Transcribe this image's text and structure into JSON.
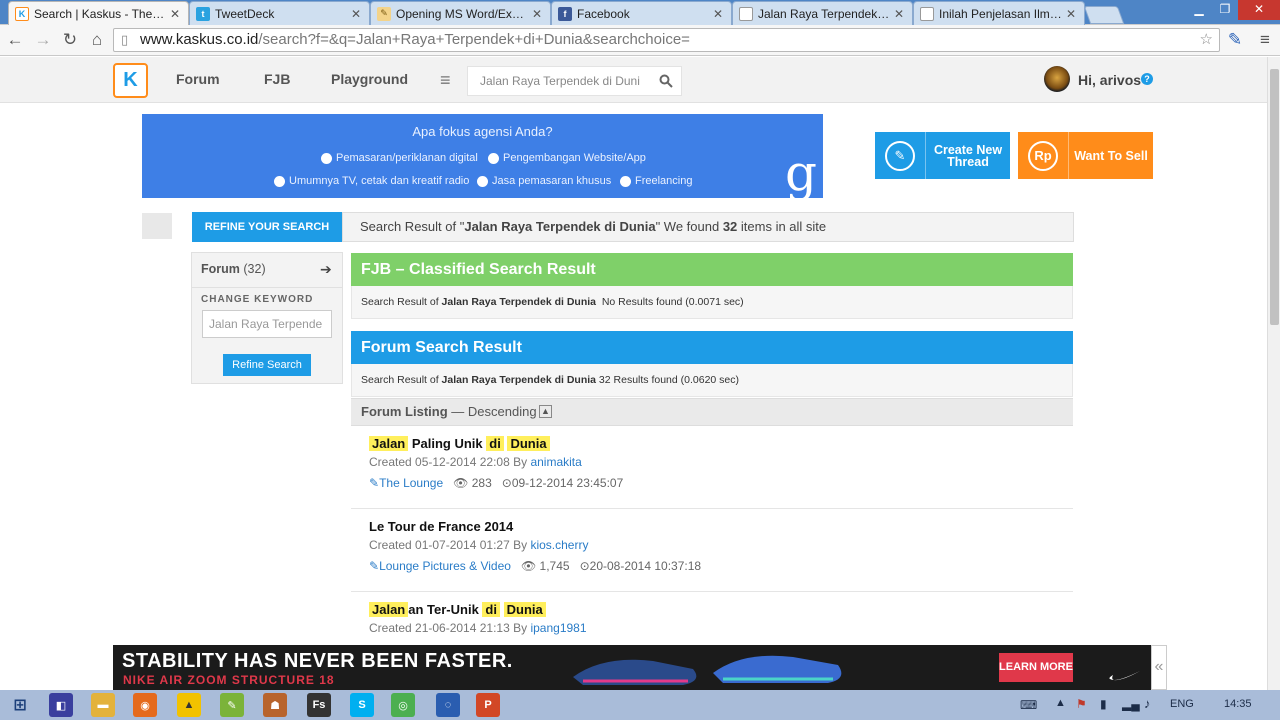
{
  "browser": {
    "tabs": [
      {
        "title": "Search | Kaskus - The Larg",
        "icon": "kaskus-icon",
        "active": true
      },
      {
        "title": "TweetDeck",
        "icon": "tweetdeck-icon",
        "active": false
      },
      {
        "title": "Opening MS Word/Excel/I",
        "icon": "document-icon",
        "active": false
      },
      {
        "title": "Facebook",
        "icon": "facebook-icon",
        "active": false
      },
      {
        "title": "Jalan Raya Terpendek di D",
        "icon": "page-icon",
        "active": false
      },
      {
        "title": "Inilah Penjelasan Ilmiah Te",
        "icon": "page-icon",
        "active": false
      }
    ],
    "url_host": "www.kaskus.co.id",
    "url_path": "/search?f=&q=Jalan+Raya+Terpendek+di+Dunia&searchchoice="
  },
  "header": {
    "nav": [
      "Forum",
      "FJB",
      "Playground"
    ],
    "search_value": "Jalan Raya Terpendek di Duni",
    "greeting": "Hi, arivos",
    "help_glyph": "?"
  },
  "ad": {
    "question": "Apa fokus agensi Anda?",
    "options": [
      "Pemasaran/periklanan digital",
      "Pengembangan Website/App",
      "Umumnya TV, cetak dan kreatif radio",
      "Jasa pemasaran khusus",
      "Freelancing"
    ],
    "logo": "g"
  },
  "actions": {
    "create_line1": "Create New",
    "create_line2": "Thread",
    "sell": "Want To Sell",
    "sell_glyph": "Rp"
  },
  "refine": {
    "tab": "REFINE YOUR SEARCH",
    "summary_prefix": "Search Result of \"",
    "summary_query": "Jalan Raya Terpendek di Dunia",
    "summary_mid": "\" We found ",
    "summary_count": "32",
    "summary_suffix": " items in all site"
  },
  "sidebar": {
    "forum_label": "Forum",
    "forum_count": "(32)",
    "change_keyword": "CHANGE KEYWORD",
    "keyword_value": "Jalan Raya Terpende",
    "refine_button": "Refine Search"
  },
  "fjb": {
    "title": "FJB – Classified Search Result",
    "prefix": "Search Result of ",
    "query": "Jalan Raya Terpendek di Dunia",
    "result": "No Results found (0.0071 sec)"
  },
  "forum": {
    "title": "Forum Search Result",
    "prefix": "Search Result of ",
    "query": "Jalan Raya Terpendek di Dunia",
    "result": "32 Results found (0.0620 sec)"
  },
  "listing": {
    "label": "Forum Listing",
    "order": "— Descending"
  },
  "threads": [
    {
      "parts": [
        {
          "text": "Jalan",
          "hl": true
        },
        {
          "text": " Paling Unik ",
          "hl": false
        },
        {
          "text": "di",
          "hl": true
        },
        {
          "text": " ",
          "hl": false
        },
        {
          "text": "Dunia",
          "hl": true
        }
      ],
      "created": "Created 05-12-2014 22:08 By",
      "author": "animakita",
      "forum": "The Lounge",
      "views": "283",
      "last": "09-12-2014 23:45:07"
    },
    {
      "parts": [
        {
          "text": "Le Tour de France 2014",
          "hl": false
        }
      ],
      "created": "Created 01-07-2014 01:27 By",
      "author": "kios.cherry",
      "forum": "Lounge Pictures & Video",
      "views": "1,745",
      "last": "20-08-2014 10:37:18"
    },
    {
      "parts": [
        {
          "text": "Jalan",
          "hl": true
        },
        {
          "text": "an Ter-Unik ",
          "hl": false
        },
        {
          "text": "di",
          "hl": true
        },
        {
          "text": " ",
          "hl": false
        },
        {
          "text": "Dunia",
          "hl": true
        }
      ],
      "created": "Created 21-06-2014 21:13 By",
      "author": "ipang1981",
      "forum": "",
      "views": "",
      "last": ""
    }
  ],
  "nike": {
    "headline": "STABILITY HAS NEVER BEEN FASTER.",
    "product": "NIKE AIR ZOOM STRUCTURE 18",
    "cta": "LEARN MORE",
    "collapse_glyph": "«"
  },
  "taskbar": {
    "lang": "ENG",
    "time": "14:35"
  },
  "colors": {
    "kaskus_blue": "#1e9ce6",
    "kaskus_orange": "#ff8c1a",
    "fjb_green": "#7fd069",
    "highlight": "#ffef5c",
    "nike_red": "#e0384a"
  }
}
